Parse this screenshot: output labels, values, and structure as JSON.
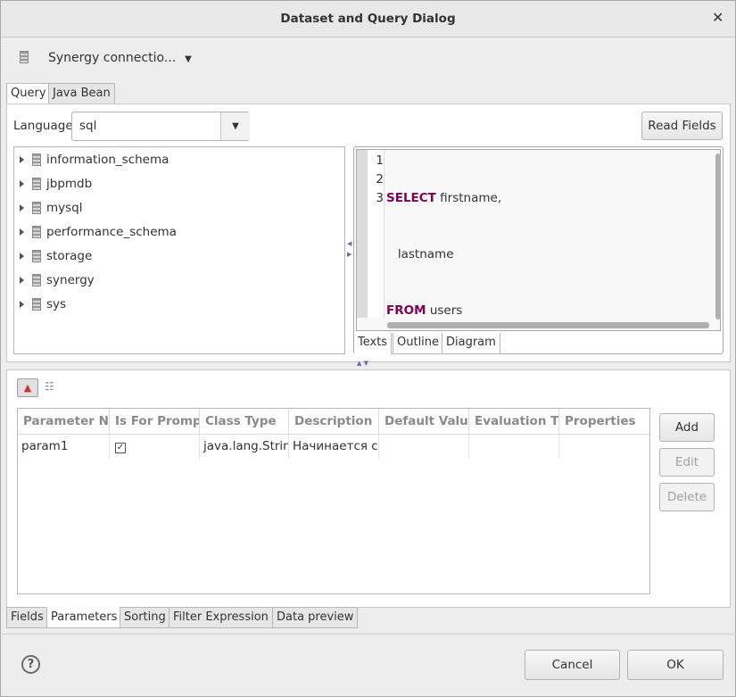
{
  "dialog": {
    "title": "Dataset and Query Dialog",
    "close_icon": "close-icon"
  },
  "connection": {
    "label": "Synergy connectio...",
    "icon": "database-icon"
  },
  "top_tabs": [
    "Query",
    "Java Bean"
  ],
  "query": {
    "language_label": "Language",
    "language_value": "sql",
    "read_fields": "Read Fields"
  },
  "tree": [
    "information_schema",
    "jbpmdb",
    "mysql",
    "performance_schema",
    "storage",
    "synergy",
    "sys"
  ],
  "editor": {
    "lines": [
      {
        "num": "1",
        "kw": "SELECT",
        "rest": " firstname,"
      },
      {
        "num": "2",
        "kw": "",
        "rest": "   lastname"
      },
      {
        "num": "3",
        "kw": "FROM",
        "rest": " users"
      }
    ],
    "tabs": [
      "Texts",
      "Outline",
      "Diagram"
    ]
  },
  "params": {
    "columns": [
      "Parameter Name",
      "Is For Prompt",
      "Class Type",
      "Description",
      "Default Value",
      "Evaluation Time",
      "Properties"
    ],
    "rows": [
      {
        "name": "param1",
        "prompt": true,
        "class": "java.lang.String",
        "description": "Начинается с",
        "default": "",
        "eval": "",
        "props": ""
      }
    ],
    "buttons": {
      "add": "Add",
      "edit": "Edit",
      "delete": "Delete"
    }
  },
  "bottom_tabs": [
    "Fields",
    "Parameters",
    "Sorting",
    "Filter Expression",
    "Data preview"
  ],
  "footer": {
    "help": "?",
    "cancel": "Cancel",
    "ok": "OK"
  },
  "colors": {
    "keyword": "#7f0055"
  }
}
